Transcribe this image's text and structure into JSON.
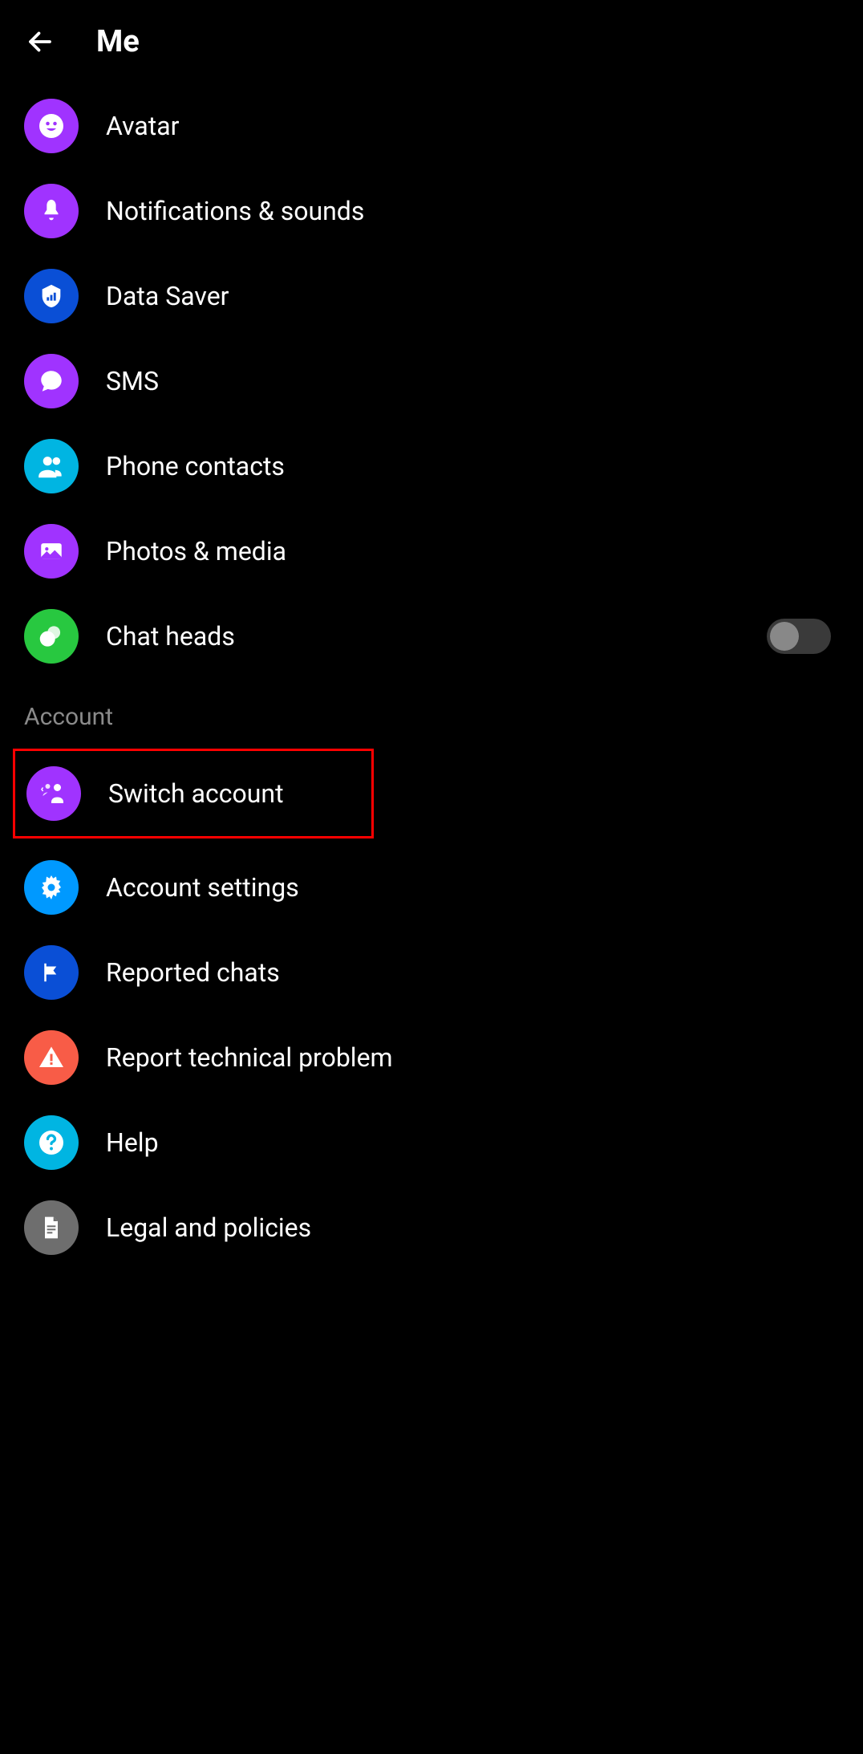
{
  "header": {
    "title": "Me"
  },
  "items": [
    {
      "label": "Avatar",
      "icon": "avatar",
      "color": "purple"
    },
    {
      "label": "Notifications & sounds",
      "icon": "bell",
      "color": "purple"
    },
    {
      "label": "Data Saver",
      "icon": "shield",
      "color": "blue"
    },
    {
      "label": "SMS",
      "icon": "sms",
      "color": "purple"
    },
    {
      "label": "Phone contacts",
      "icon": "people",
      "color": "cyan"
    },
    {
      "label": "Photos & media",
      "icon": "photo",
      "color": "purple"
    },
    {
      "label": "Chat heads",
      "icon": "chatheads",
      "color": "green",
      "toggle": false
    }
  ],
  "sectionHeader": "Account",
  "accountItems": [
    {
      "label": "Switch account",
      "icon": "switch",
      "color": "purple",
      "highlighted": true
    },
    {
      "label": "Account settings",
      "icon": "gear",
      "color": "lightblue"
    },
    {
      "label": "Reported chats",
      "icon": "flag",
      "color": "blue"
    },
    {
      "label": "Report technical problem",
      "icon": "warning",
      "color": "orange"
    },
    {
      "label": "Help",
      "icon": "help",
      "color": "cyan"
    },
    {
      "label": "Legal and policies",
      "icon": "document",
      "color": "grey"
    }
  ]
}
